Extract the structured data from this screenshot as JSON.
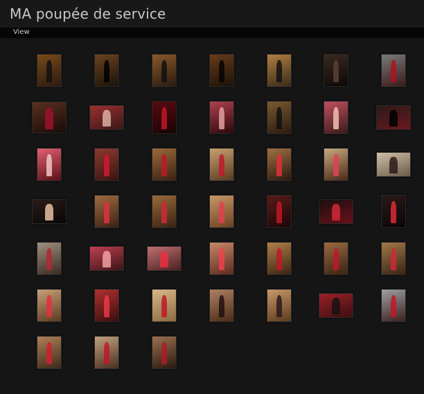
{
  "header": {
    "title": "MA poupée de service"
  },
  "menu": {
    "view_label": "View"
  },
  "gallery": {
    "thumbnails": [
      {
        "c1": "#7a4a1a",
        "c2": "#2a1a10",
        "fig": "#111"
      },
      {
        "c1": "#6a4420",
        "c2": "#1a120a",
        "fig": "#000"
      },
      {
        "c1": "#8a5a28",
        "c2": "#2a1a12",
        "fig": "#111"
      },
      {
        "c1": "#6a3a1a",
        "c2": "#1a1208",
        "fig": "#050505"
      },
      {
        "c1": "#b08040",
        "c2": "#3a2a18",
        "fig": "#111"
      },
      {
        "c1": "#3a2a20",
        "c2": "#0a0808",
        "fig": "#5a4030"
      },
      {
        "c1": "#7a7a7a",
        "c2": "#3a1a1a",
        "fig": "#b01020"
      },
      {
        "c1": "#5a3020",
        "c2": "#1a0a08",
        "fig": "#a0102a"
      },
      {
        "c1": "#9a3030",
        "c2": "#3a1818",
        "fig": "#d8b0a0"
      },
      {
        "c1": "#5a0a10",
        "c2": "#150405",
        "fig": "#c01828"
      },
      {
        "c1": "#b04050",
        "c2": "#2a0808",
        "fig": "#e0a0a0"
      },
      {
        "c1": "#7a5a30",
        "c2": "#2a1a10",
        "fig": "#111"
      },
      {
        "c1": "#c05060",
        "c2": "#3a1a1a",
        "fig": "#f0c0b0"
      },
      {
        "c1": "#2a1a18",
        "c2": "#6a1820",
        "fig": "#000"
      },
      {
        "c1": "#e06070",
        "c2": "#5a1018",
        "fig": "#f0c8c0"
      },
      {
        "c1": "#8a3a30",
        "c2": "#3a1410",
        "fig": "#d01830"
      },
      {
        "c1": "#9a6a38",
        "c2": "#3a2214",
        "fig": "#c01828"
      },
      {
        "c1": "#c8a070",
        "c2": "#5a3a20",
        "fig": "#c01a2a"
      },
      {
        "c1": "#a07040",
        "c2": "#2a1a10",
        "fig": "#e0303a"
      },
      {
        "c1": "#c8a880",
        "c2": "#4a2a18",
        "fig": "#e84050"
      },
      {
        "c1": "#d0c0a8",
        "c2": "#6a5a48",
        "fig": "#2a1a1a"
      },
      {
        "c1": "#2a1c18",
        "c2": "#080606",
        "fig": "#e8c0a0"
      },
      {
        "c1": "#a06a40",
        "c2": "#3a2214",
        "fig": "#e03040"
      },
      {
        "c1": "#9a6a38",
        "c2": "#3a2214",
        "fig": "#d02838"
      },
      {
        "c1": "#c89868",
        "c2": "#6a4020",
        "fig": "#e04050"
      },
      {
        "c1": "#5a1a18",
        "c2": "#1a0808",
        "fig": "#c01828"
      },
      {
        "c1": "#1a1010",
        "c2": "#6a1018",
        "fig": "#d02838"
      },
      {
        "c1": "#2a1a18",
        "c2": "#0a0606",
        "fig": "#e02838"
      },
      {
        "c1": "#a09080",
        "c2": "#3a2a20",
        "fig": "#b02838"
      },
      {
        "c1": "#c04050",
        "c2": "#3a1418",
        "fig": "#f0a0a0"
      },
      {
        "c1": "#c07070",
        "c2": "#4a2020",
        "fig": "#e83040"
      },
      {
        "c1": "#c88868",
        "c2": "#5a2a20",
        "fig": "#f04050"
      },
      {
        "c1": "#b08048",
        "c2": "#3a2414",
        "fig": "#c01828"
      },
      {
        "c1": "#9a6a40",
        "c2": "#3a2214",
        "fig": "#c01828"
      },
      {
        "c1": "#a07848",
        "c2": "#3a2414",
        "fig": "#d02838"
      },
      {
        "c1": "#c8a078",
        "c2": "#5a3a20",
        "fig": "#e03040"
      },
      {
        "c1": "#b03030",
        "c2": "#3a0e10",
        "fig": "#e83848"
      },
      {
        "c1": "#d8b888",
        "c2": "#8a6a40",
        "fig": "#c01828"
      },
      {
        "c1": "#b08060",
        "c2": "#4a2a18",
        "fig": "#201010"
      },
      {
        "c1": "#c89868",
        "c2": "#5a3a20",
        "fig": "#2a1a1a"
      },
      {
        "c1": "#9a2028",
        "c2": "#3a1010",
        "fig": "#1a1010"
      },
      {
        "c1": "#a0a0a0",
        "c2": "#3a2020",
        "fig": "#c01828"
      },
      {
        "c1": "#b08058",
        "c2": "#3a2a1a",
        "fig": "#d02030"
      },
      {
        "c1": "#c0a080",
        "c2": "#4a3020",
        "fig": "#c01828"
      },
      {
        "c1": "#9a7050",
        "c2": "#2a1a10",
        "fig": "#b01a28"
      }
    ]
  }
}
